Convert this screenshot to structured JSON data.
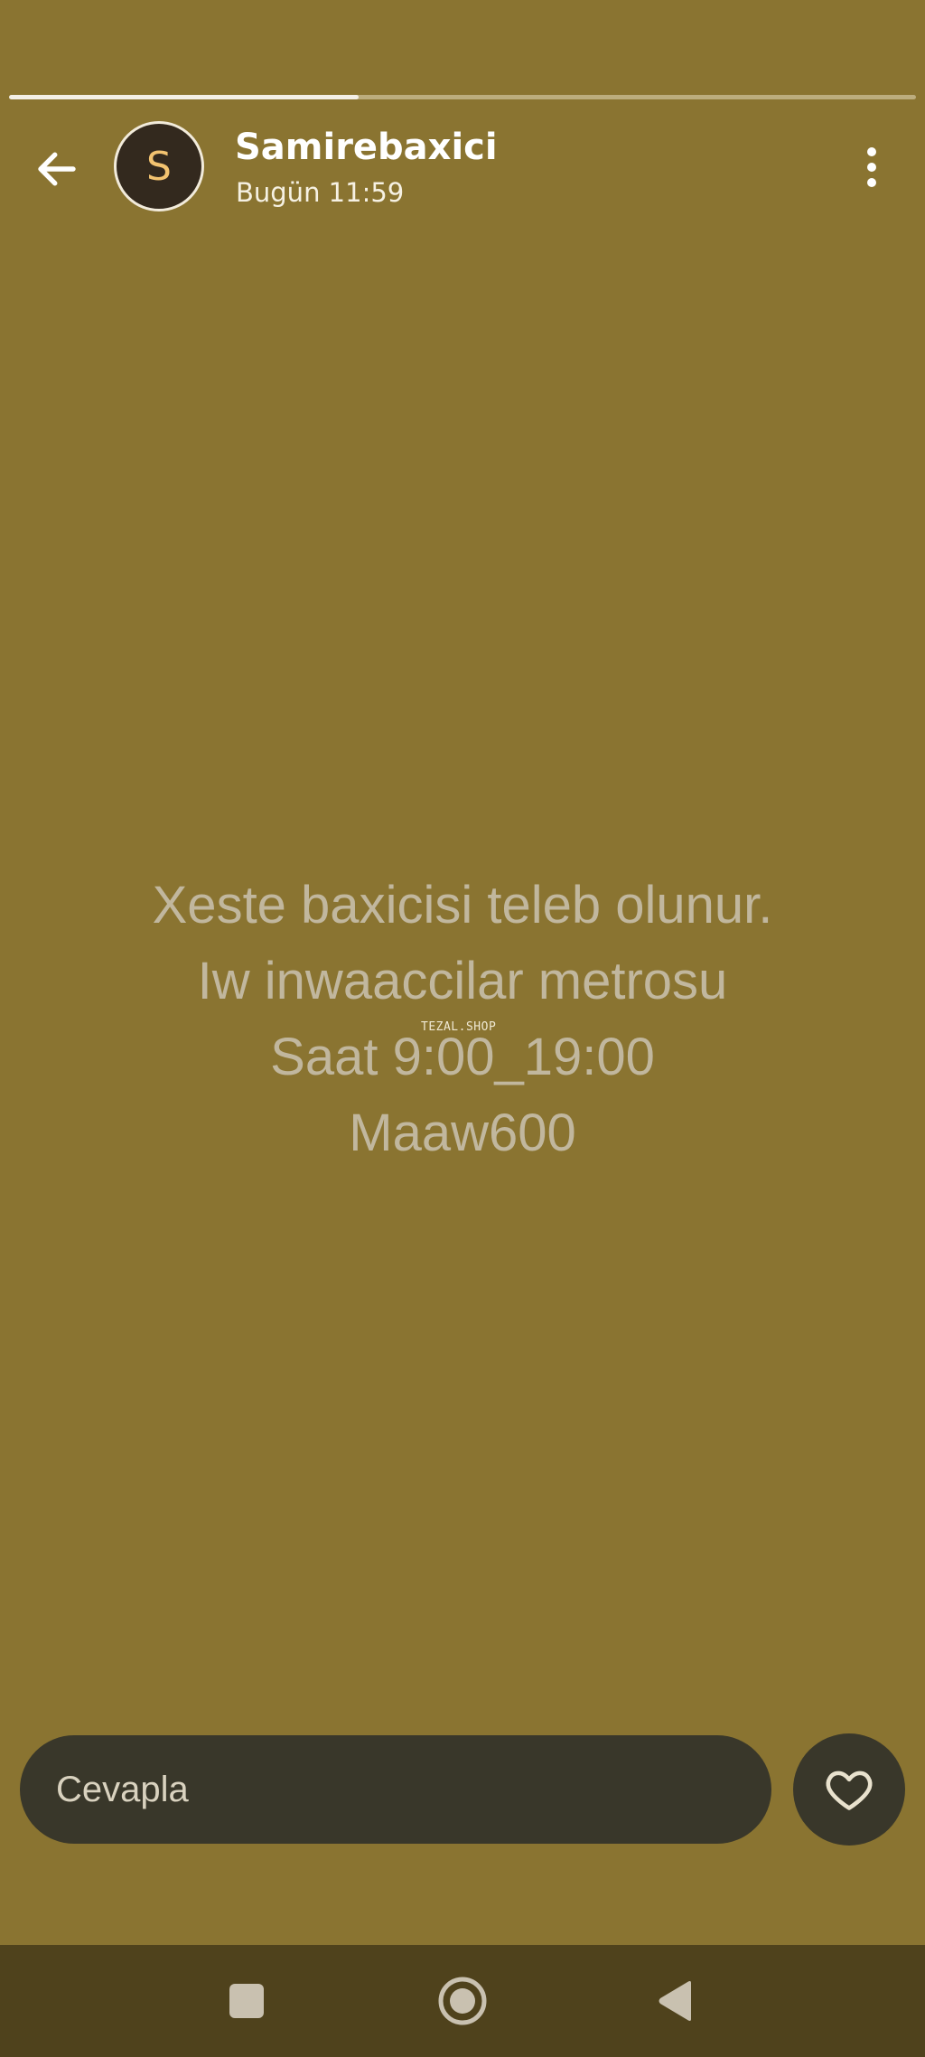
{
  "story": {
    "progress_fraction": 0.385,
    "author_initial": "S",
    "author_name": "Samirebaxici",
    "posted_time": "Bugün 11:59",
    "lines": [
      "Xeste baxicisi teleb olunur.",
      "Iw inwaaccilar metrosu",
      "Saat 9:00_19:00",
      "Maaw600"
    ],
    "watermark": "TEZAL.SHOP"
  },
  "reply": {
    "placeholder": "Cevapla"
  },
  "icons": {
    "back": "arrow-left-icon",
    "more": "more-vertical-icon",
    "like": "heart-icon",
    "nav_recents": "square-icon",
    "nav_home": "circle-icon",
    "nav_back": "triangle-back-icon"
  },
  "colors": {
    "background": "#8a7431",
    "avatar_bg": "#33291e",
    "avatar_letter": "#f3c370",
    "input_bg": "#39372a",
    "nav_bar": "#4f421c",
    "story_text": "#c1b79e"
  }
}
